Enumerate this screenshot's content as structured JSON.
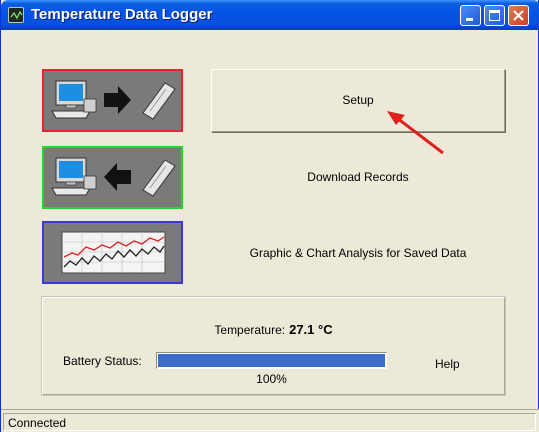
{
  "window": {
    "title": "Temperature Data Logger",
    "controls": {
      "minimize_icon": "minimize-icon",
      "maximize_icon": "maximize-icon",
      "close_icon": "close-icon"
    }
  },
  "actions": {
    "setup": {
      "label": "Setup",
      "icon": "computer-to-device-icon",
      "border_color": "#E0282B"
    },
    "download": {
      "label": "Download Records",
      "icon": "device-to-computer-icon",
      "border_color": "#29D32A"
    },
    "graph": {
      "label": "Graphic & Chart Analysis for Saved Data",
      "icon": "chart-icon",
      "border_color": "#3A3ACF"
    }
  },
  "status_panel": {
    "temperature_label": "Temperature:",
    "temperature_value": "27.1 °C",
    "battery_label": "Battery Status:",
    "battery_percent_text": "100%",
    "battery_level": 1.0,
    "help_label": "Help"
  },
  "statusbar": {
    "text": "Connected"
  },
  "colors": {
    "titlebar": "#0453E6",
    "progress": "#3B6DC8",
    "annotation_arrow": "#E0201C",
    "window_bg": "#ECE9D8"
  }
}
